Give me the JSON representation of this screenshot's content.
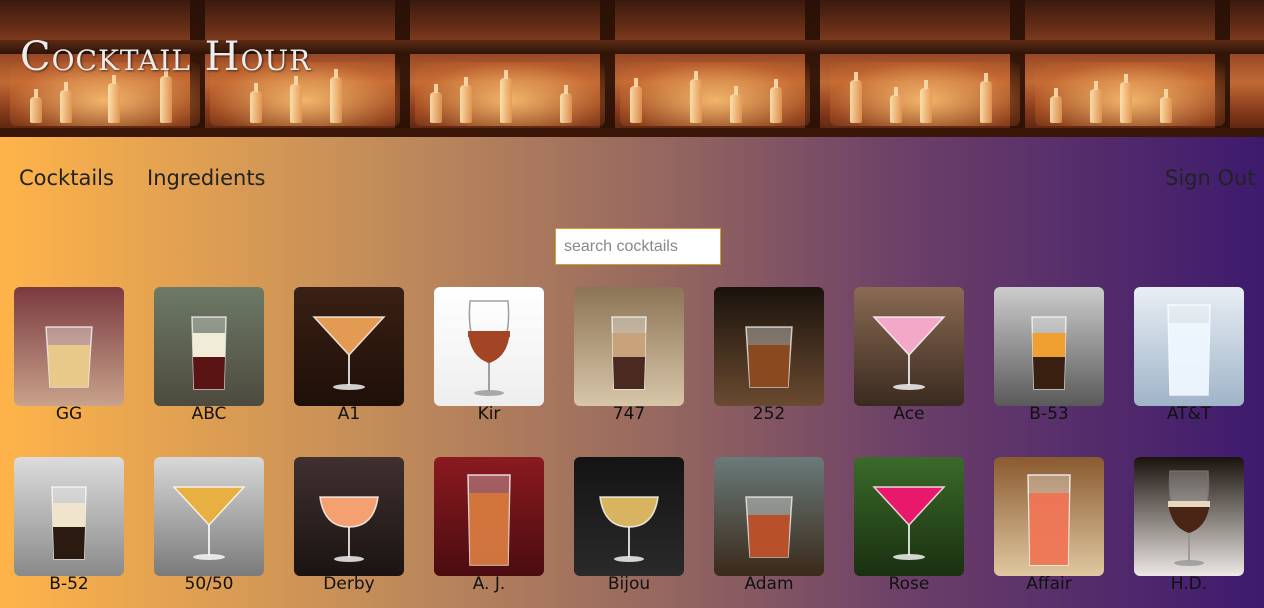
{
  "header": {
    "title": "Cocktail Hour"
  },
  "nav": {
    "cocktails_label": "Cocktails",
    "ingredients_label": "Ingredients",
    "signout_label": "Sign Out"
  },
  "search": {
    "placeholder": "search cocktails",
    "value": ""
  },
  "cocktails": [
    {
      "name": "GG"
    },
    {
      "name": "ABC"
    },
    {
      "name": "A1"
    },
    {
      "name": "Kir"
    },
    {
      "name": "747"
    },
    {
      "name": "252"
    },
    {
      "name": "Ace"
    },
    {
      "name": "B-53"
    },
    {
      "name": "AT&T"
    },
    {
      "name": "B-52"
    },
    {
      "name": "50/50"
    },
    {
      "name": "Derby"
    },
    {
      "name": "A. J."
    },
    {
      "name": "Bijou"
    },
    {
      "name": "Adam"
    },
    {
      "name": "Rose"
    },
    {
      "name": "Affair"
    },
    {
      "name": "H.D."
    }
  ]
}
